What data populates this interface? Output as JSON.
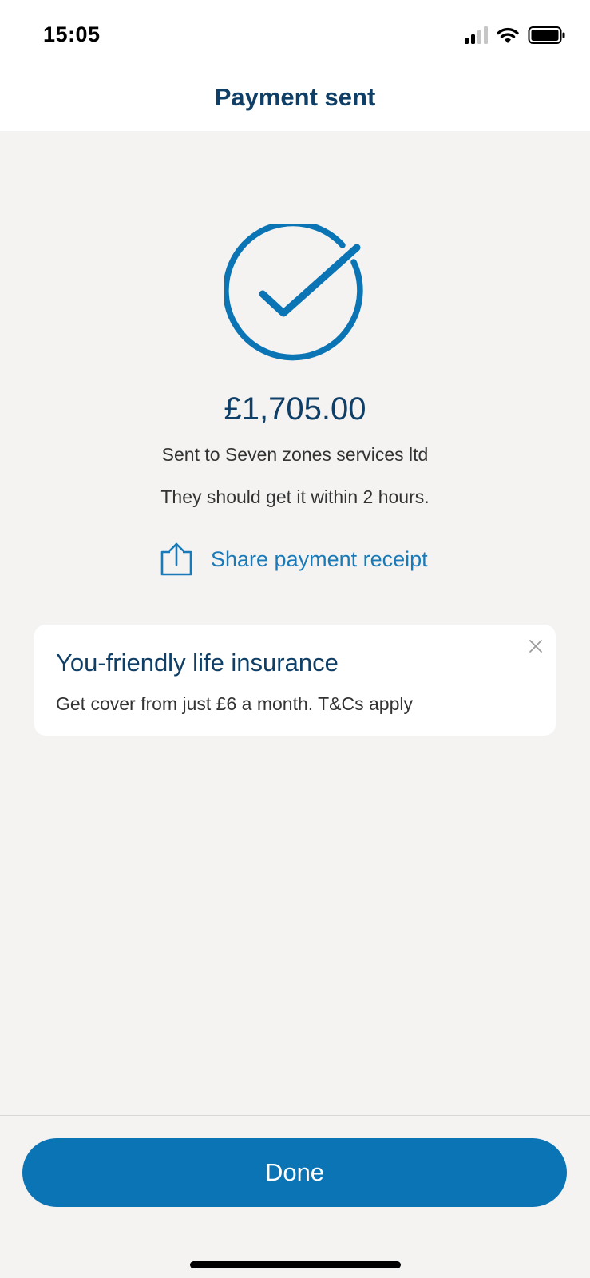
{
  "status_bar": {
    "time": "15:05",
    "icons": [
      "signal-icon",
      "wifi-icon",
      "battery-icon"
    ]
  },
  "header": {
    "title": "Payment sent"
  },
  "confirmation": {
    "icon": "check-circle-icon",
    "amount": "£1,705.00",
    "recipient": "Sent to Seven zones services ltd",
    "eta": "They should get it within 2 hours.",
    "share_label": "Share payment receipt",
    "share_icon": "share-icon"
  },
  "promo": {
    "title": "You-friendly life insurance",
    "body": "Get cover from just £6 a month. T&Cs apply",
    "close_icon": "close-icon"
  },
  "footer": {
    "done_label": "Done"
  },
  "colors": {
    "brand_blue": "#0a74b5",
    "heading_navy": "#0f3f66",
    "link_blue": "#1a7ab8",
    "background": "#f4f3f2"
  }
}
